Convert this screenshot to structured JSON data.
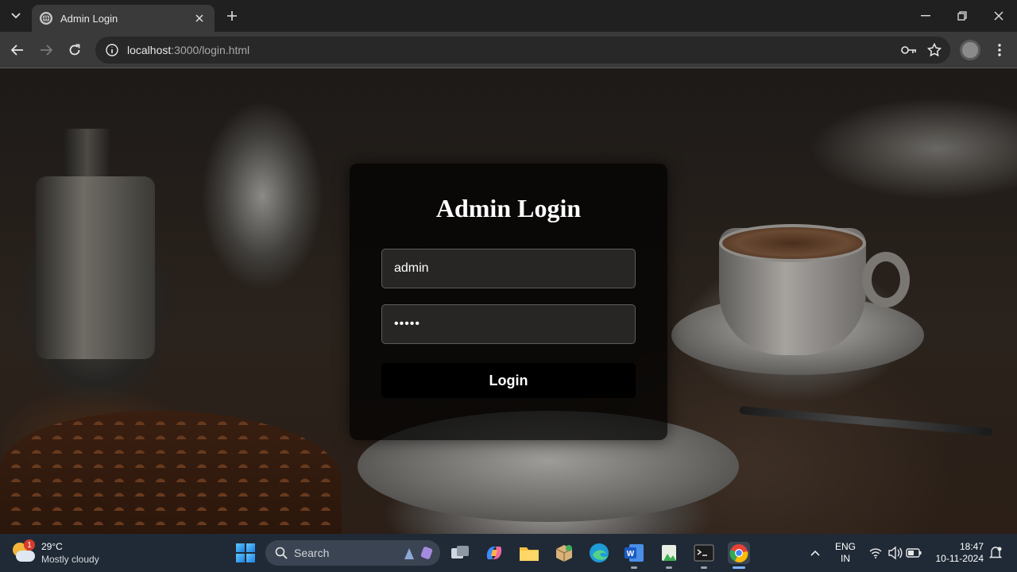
{
  "browser": {
    "tab_title": "Admin Login",
    "url_host": "localhost",
    "url_path": ":3000/login.html"
  },
  "login": {
    "title": "Admin Login",
    "username_value": "admin",
    "password_value": "•••••",
    "button_label": "Login"
  },
  "taskbar": {
    "weather_temp": "29°C",
    "weather_condition": "Mostly cloudy",
    "weather_badge": "1",
    "search_label": "Search",
    "lang_top": "ENG",
    "lang_bottom": "IN",
    "time": "18:47",
    "date": "10-11-2024"
  },
  "colors": {
    "card_bg": "#000000b8",
    "button_bg": "#000000",
    "taskbar_bg": "#202a36",
    "chrome_bg": "#202020"
  }
}
